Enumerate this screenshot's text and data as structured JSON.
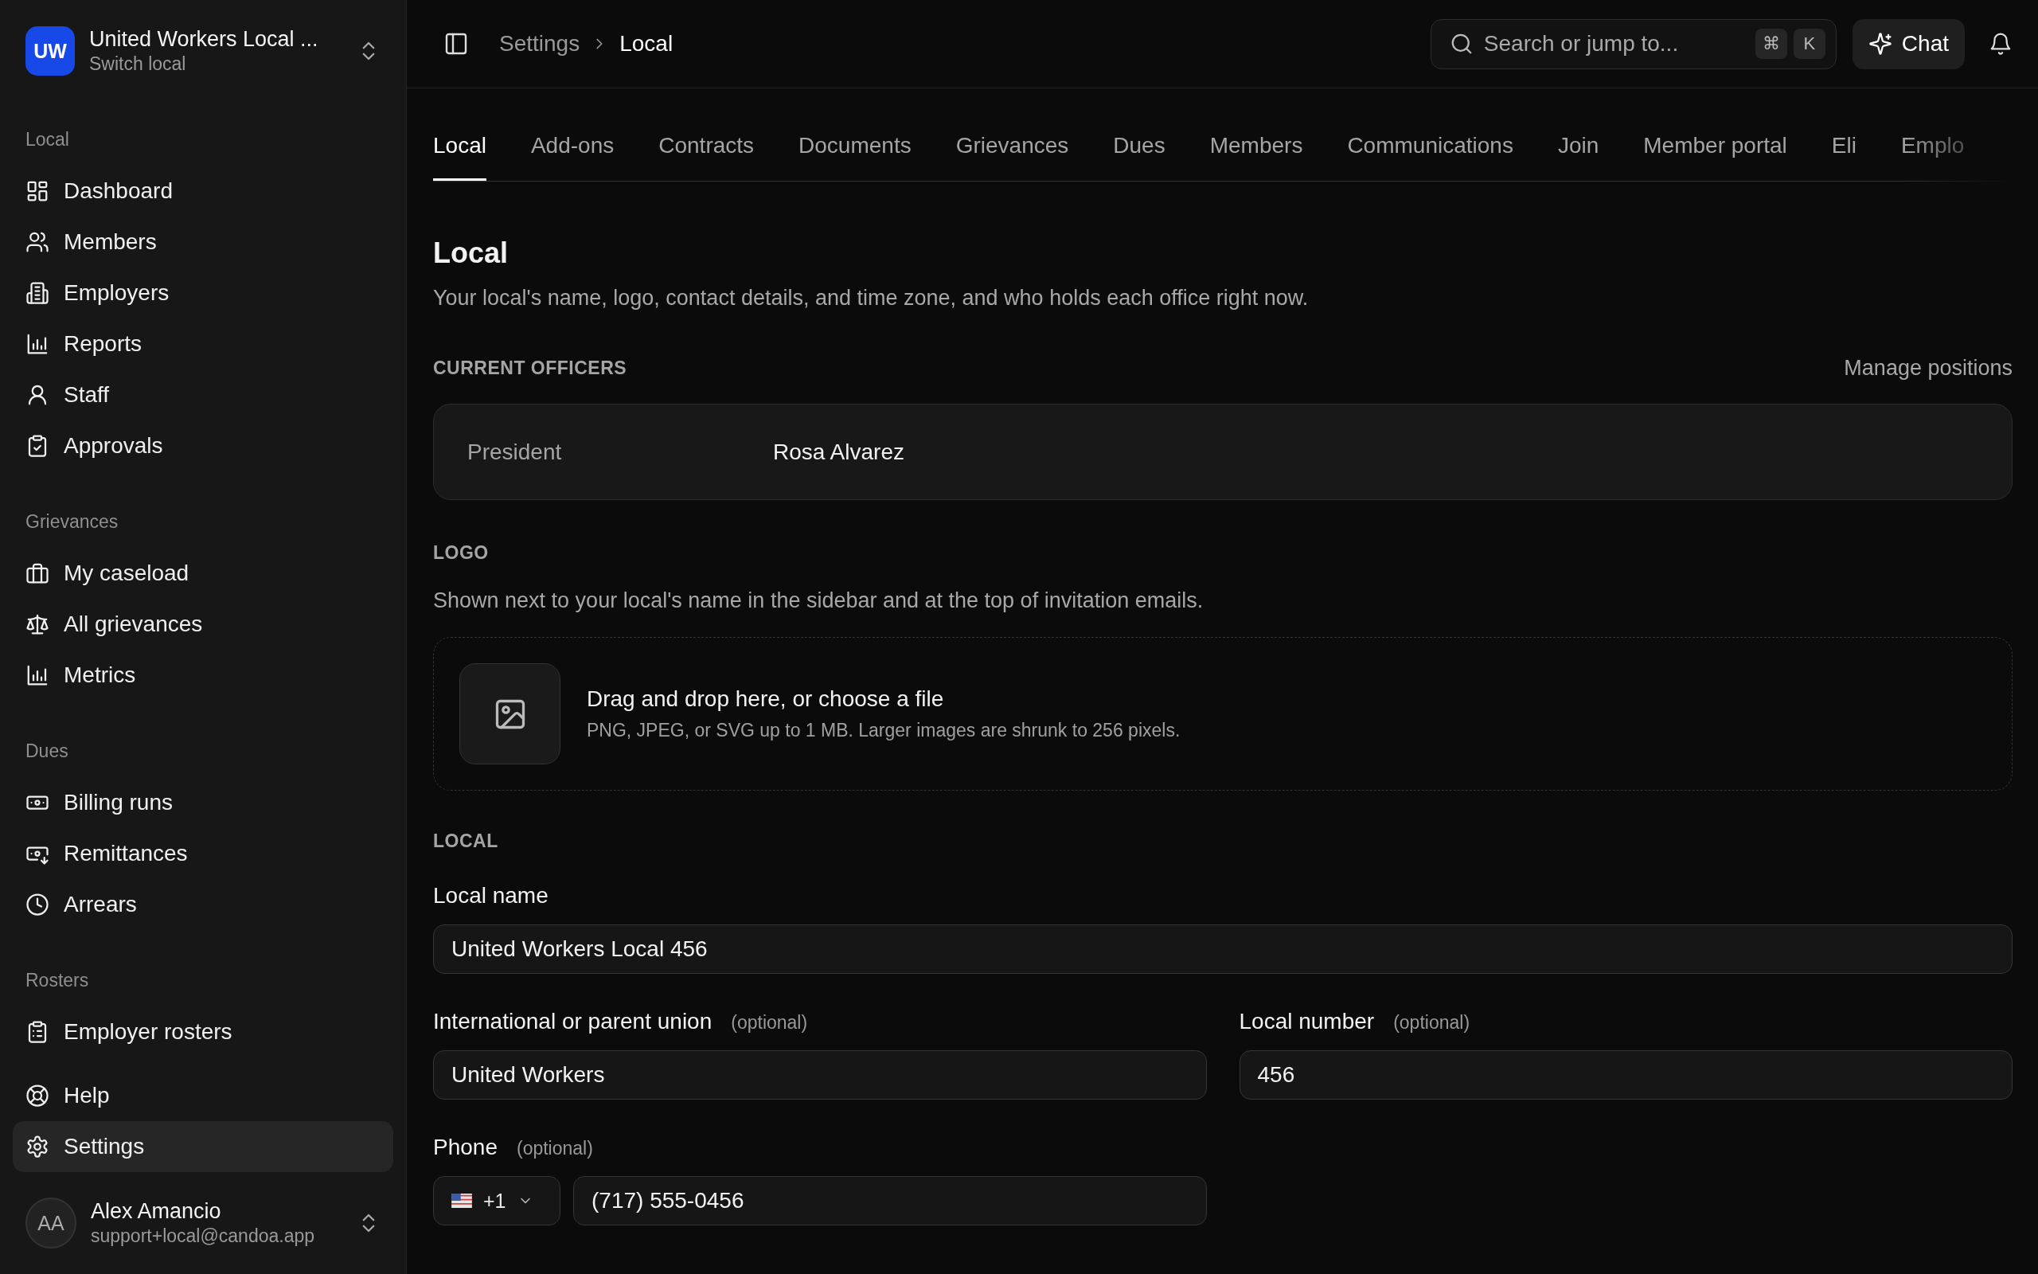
{
  "workspace": {
    "initials": "UW",
    "name": "United Workers Local ...",
    "subtitle": "Switch local"
  },
  "sidebar": {
    "sections": [
      {
        "label": "Local",
        "items": [
          {
            "label": "Dashboard",
            "selected": false
          },
          {
            "label": "Members",
            "selected": false
          },
          {
            "label": "Employers",
            "selected": false
          },
          {
            "label": "Reports",
            "selected": false
          },
          {
            "label": "Staff",
            "selected": false
          },
          {
            "label": "Approvals",
            "selected": false
          }
        ]
      },
      {
        "label": "Grievances",
        "items": [
          {
            "label": "My caseload",
            "selected": false
          },
          {
            "label": "All grievances",
            "selected": false
          },
          {
            "label": "Metrics",
            "selected": false
          }
        ]
      },
      {
        "label": "Dues",
        "items": [
          {
            "label": "Billing runs",
            "selected": false
          },
          {
            "label": "Remittances",
            "selected": false
          },
          {
            "label": "Arrears",
            "selected": false
          }
        ]
      },
      {
        "label": "Rosters",
        "items": [
          {
            "label": "Employer rosters",
            "selected": false
          }
        ]
      }
    ],
    "footer_items": [
      {
        "label": "Help",
        "selected": false
      },
      {
        "label": "Settings",
        "selected": true
      }
    ]
  },
  "user": {
    "initials": "AA",
    "name": "Alex Amancio",
    "email": "support+local@candoa.app"
  },
  "topbar": {
    "breadcrumb": [
      {
        "label": "Settings",
        "current": false
      },
      {
        "label": "Local",
        "current": true
      }
    ],
    "search": {
      "placeholder": "Search or jump to...",
      "keys": [
        "⌘",
        "K"
      ]
    },
    "chat_button": "Chat"
  },
  "tabs": [
    {
      "label": "Local",
      "selected": true
    },
    {
      "label": "Add-ons",
      "selected": false
    },
    {
      "label": "Contracts",
      "selected": false
    },
    {
      "label": "Documents",
      "selected": false
    },
    {
      "label": "Grievances",
      "selected": false
    },
    {
      "label": "Dues",
      "selected": false
    },
    {
      "label": "Members",
      "selected": false
    },
    {
      "label": "Communications",
      "selected": false
    },
    {
      "label": "Join",
      "selected": false
    },
    {
      "label": "Member portal",
      "selected": false
    },
    {
      "label": "Eli",
      "selected": false
    },
    {
      "label": "Emplo",
      "selected": false
    }
  ],
  "page": {
    "title": "Local",
    "description": "Your local's name, logo, contact details, and time zone, and who holds each office right now."
  },
  "officers": {
    "heading": "CURRENT OFFICERS",
    "action": "Manage positions",
    "rows": [
      {
        "position": "President",
        "holder": "Rosa Alvarez"
      }
    ]
  },
  "logo": {
    "heading": "LOGO",
    "description": "Shown next to your local's name in the sidebar and at the top of invitation emails.",
    "dropzone": {
      "title": "Drag and drop here, or choose a file",
      "hint": "PNG, JPEG, or SVG up to 1 MB. Larger images are shrunk to 256 pixels."
    }
  },
  "local": {
    "heading": "LOCAL",
    "fields": [
      {
        "kind": "wide",
        "label": "Local name",
        "value": "United Workers Local 456"
      },
      {
        "kind": "text",
        "label": "International or parent union",
        "optional": "(optional)",
        "value": "United Workers"
      },
      {
        "kind": "text",
        "label": "Local number",
        "optional": "(optional)",
        "value": "456"
      },
      {
        "kind": "phone",
        "label": "Phone",
        "optional": "(optional)",
        "country_code": "+1",
        "value": "(717) 555-0456"
      }
    ]
  }
}
